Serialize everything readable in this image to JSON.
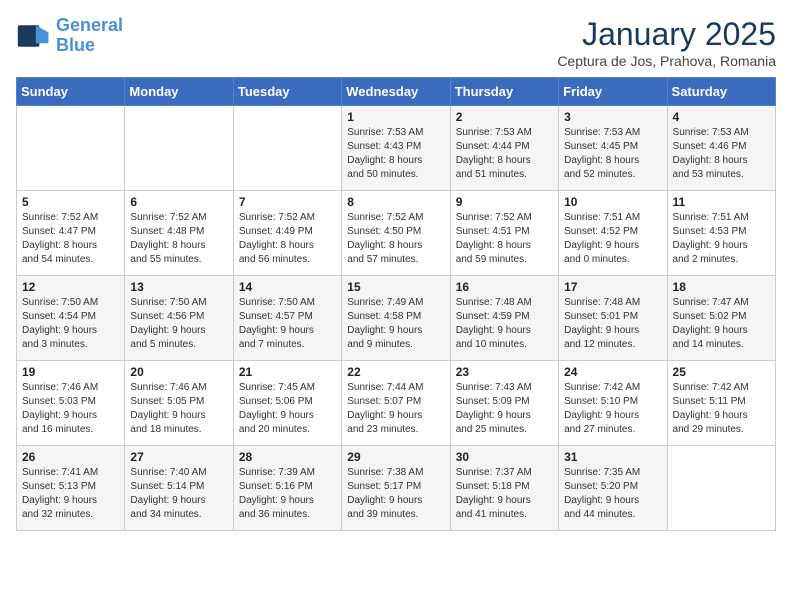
{
  "header": {
    "logo_line1": "General",
    "logo_line2": "Blue",
    "month_title": "January 2025",
    "subtitle": "Ceptura de Jos, Prahova, Romania"
  },
  "weekdays": [
    "Sunday",
    "Monday",
    "Tuesday",
    "Wednesday",
    "Thursday",
    "Friday",
    "Saturday"
  ],
  "weeks": [
    [
      {
        "day": "",
        "info": ""
      },
      {
        "day": "",
        "info": ""
      },
      {
        "day": "",
        "info": ""
      },
      {
        "day": "1",
        "info": "Sunrise: 7:53 AM\nSunset: 4:43 PM\nDaylight: 8 hours\nand 50 minutes."
      },
      {
        "day": "2",
        "info": "Sunrise: 7:53 AM\nSunset: 4:44 PM\nDaylight: 8 hours\nand 51 minutes."
      },
      {
        "day": "3",
        "info": "Sunrise: 7:53 AM\nSunset: 4:45 PM\nDaylight: 8 hours\nand 52 minutes."
      },
      {
        "day": "4",
        "info": "Sunrise: 7:53 AM\nSunset: 4:46 PM\nDaylight: 8 hours\nand 53 minutes."
      }
    ],
    [
      {
        "day": "5",
        "info": "Sunrise: 7:52 AM\nSunset: 4:47 PM\nDaylight: 8 hours\nand 54 minutes."
      },
      {
        "day": "6",
        "info": "Sunrise: 7:52 AM\nSunset: 4:48 PM\nDaylight: 8 hours\nand 55 minutes."
      },
      {
        "day": "7",
        "info": "Sunrise: 7:52 AM\nSunset: 4:49 PM\nDaylight: 8 hours\nand 56 minutes."
      },
      {
        "day": "8",
        "info": "Sunrise: 7:52 AM\nSunset: 4:50 PM\nDaylight: 8 hours\nand 57 minutes."
      },
      {
        "day": "9",
        "info": "Sunrise: 7:52 AM\nSunset: 4:51 PM\nDaylight: 8 hours\nand 59 minutes."
      },
      {
        "day": "10",
        "info": "Sunrise: 7:51 AM\nSunset: 4:52 PM\nDaylight: 9 hours\nand 0 minutes."
      },
      {
        "day": "11",
        "info": "Sunrise: 7:51 AM\nSunset: 4:53 PM\nDaylight: 9 hours\nand 2 minutes."
      }
    ],
    [
      {
        "day": "12",
        "info": "Sunrise: 7:50 AM\nSunset: 4:54 PM\nDaylight: 9 hours\nand 3 minutes."
      },
      {
        "day": "13",
        "info": "Sunrise: 7:50 AM\nSunset: 4:56 PM\nDaylight: 9 hours\nand 5 minutes."
      },
      {
        "day": "14",
        "info": "Sunrise: 7:50 AM\nSunset: 4:57 PM\nDaylight: 9 hours\nand 7 minutes."
      },
      {
        "day": "15",
        "info": "Sunrise: 7:49 AM\nSunset: 4:58 PM\nDaylight: 9 hours\nand 9 minutes."
      },
      {
        "day": "16",
        "info": "Sunrise: 7:48 AM\nSunset: 4:59 PM\nDaylight: 9 hours\nand 10 minutes."
      },
      {
        "day": "17",
        "info": "Sunrise: 7:48 AM\nSunset: 5:01 PM\nDaylight: 9 hours\nand 12 minutes."
      },
      {
        "day": "18",
        "info": "Sunrise: 7:47 AM\nSunset: 5:02 PM\nDaylight: 9 hours\nand 14 minutes."
      }
    ],
    [
      {
        "day": "19",
        "info": "Sunrise: 7:46 AM\nSunset: 5:03 PM\nDaylight: 9 hours\nand 16 minutes."
      },
      {
        "day": "20",
        "info": "Sunrise: 7:46 AM\nSunset: 5:05 PM\nDaylight: 9 hours\nand 18 minutes."
      },
      {
        "day": "21",
        "info": "Sunrise: 7:45 AM\nSunset: 5:06 PM\nDaylight: 9 hours\nand 20 minutes."
      },
      {
        "day": "22",
        "info": "Sunrise: 7:44 AM\nSunset: 5:07 PM\nDaylight: 9 hours\nand 23 minutes."
      },
      {
        "day": "23",
        "info": "Sunrise: 7:43 AM\nSunset: 5:09 PM\nDaylight: 9 hours\nand 25 minutes."
      },
      {
        "day": "24",
        "info": "Sunrise: 7:42 AM\nSunset: 5:10 PM\nDaylight: 9 hours\nand 27 minutes."
      },
      {
        "day": "25",
        "info": "Sunrise: 7:42 AM\nSunset: 5:11 PM\nDaylight: 9 hours\nand 29 minutes."
      }
    ],
    [
      {
        "day": "26",
        "info": "Sunrise: 7:41 AM\nSunset: 5:13 PM\nDaylight: 9 hours\nand 32 minutes."
      },
      {
        "day": "27",
        "info": "Sunrise: 7:40 AM\nSunset: 5:14 PM\nDaylight: 9 hours\nand 34 minutes."
      },
      {
        "day": "28",
        "info": "Sunrise: 7:39 AM\nSunset: 5:16 PM\nDaylight: 9 hours\nand 36 minutes."
      },
      {
        "day": "29",
        "info": "Sunrise: 7:38 AM\nSunset: 5:17 PM\nDaylight: 9 hours\nand 39 minutes."
      },
      {
        "day": "30",
        "info": "Sunrise: 7:37 AM\nSunset: 5:18 PM\nDaylight: 9 hours\nand 41 minutes."
      },
      {
        "day": "31",
        "info": "Sunrise: 7:35 AM\nSunset: 5:20 PM\nDaylight: 9 hours\nand 44 minutes."
      },
      {
        "day": "",
        "info": ""
      }
    ]
  ]
}
